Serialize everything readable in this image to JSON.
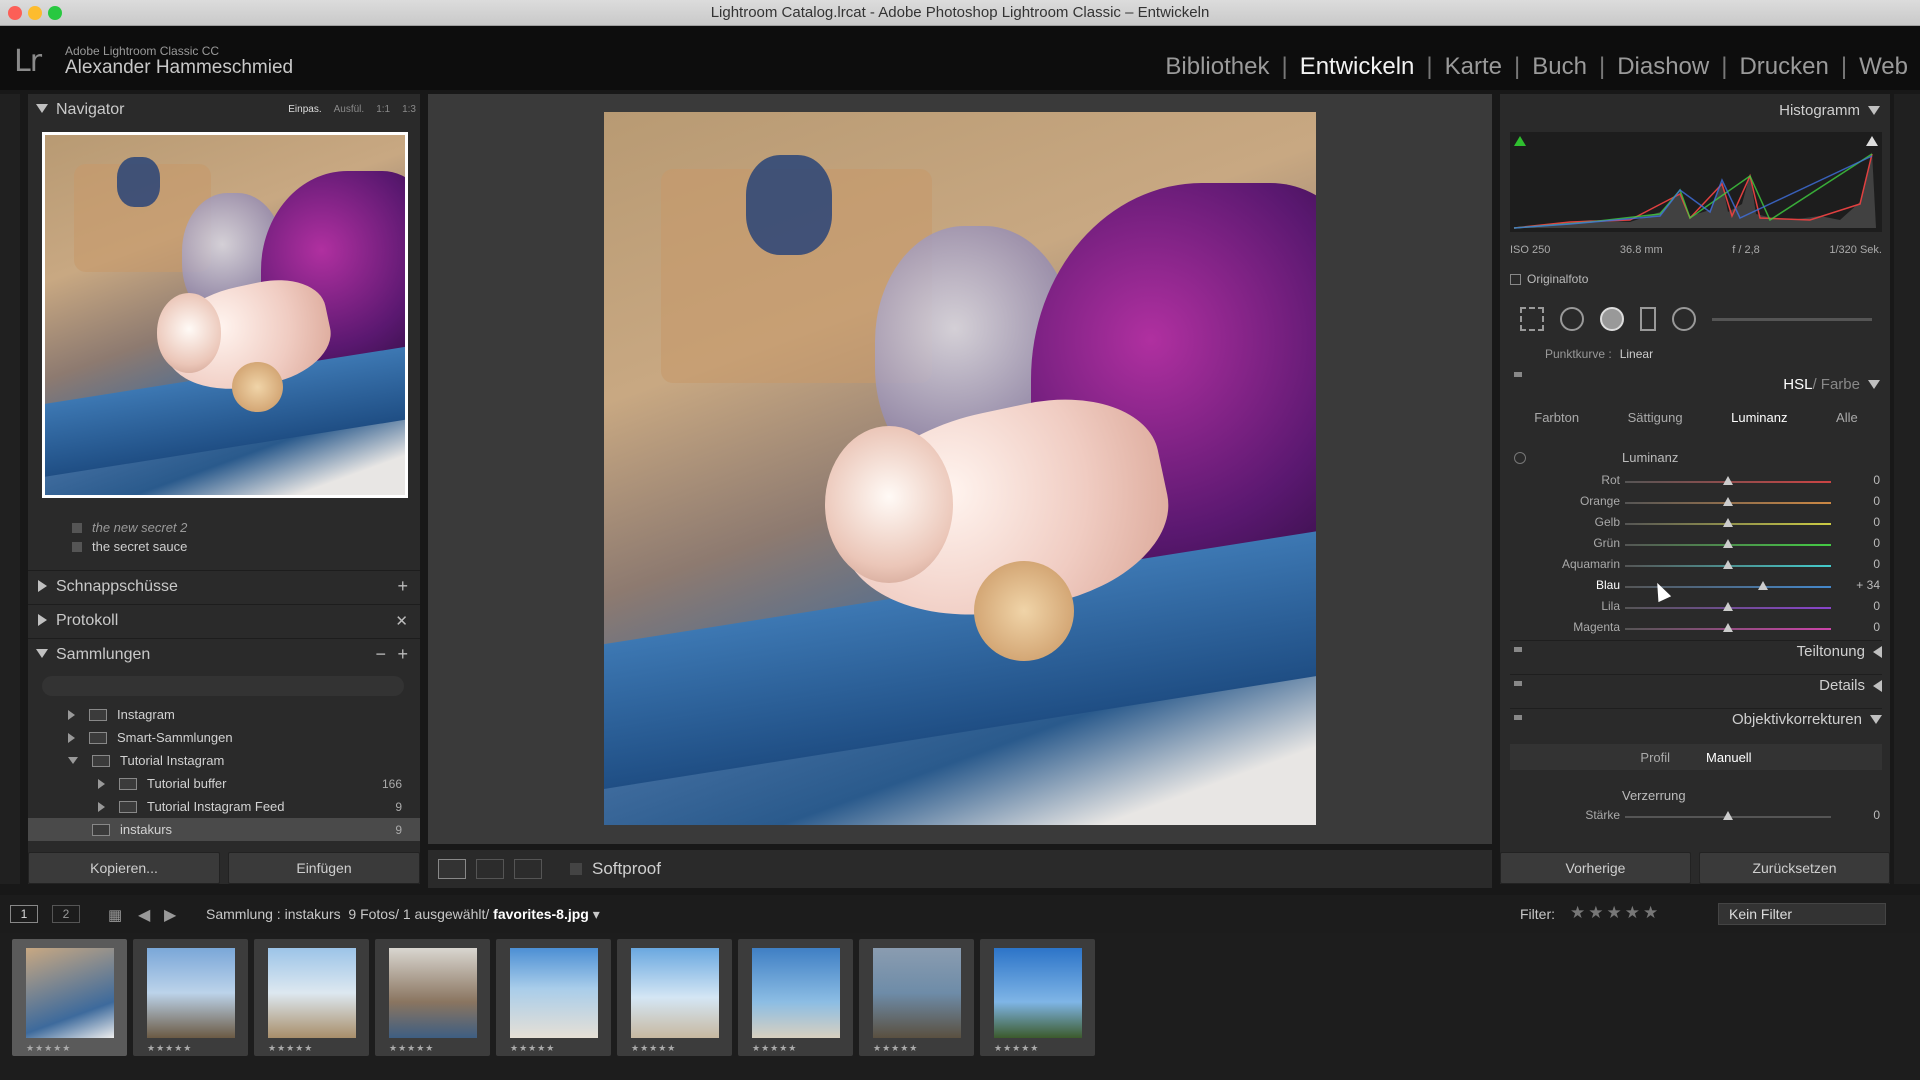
{
  "window": {
    "title": "Lightroom Catalog.lrcat - Adobe Photoshop Lightroom Classic – Entwickeln"
  },
  "header": {
    "logo": "Lr",
    "product": "Adobe Lightroom Classic CC",
    "user": "Alexander Hammeschmied",
    "modules": [
      "Bibliothek",
      "Entwickeln",
      "Karte",
      "Buch",
      "Diashow",
      "Drucken",
      "Web"
    ],
    "active_module": "Entwickeln"
  },
  "left": {
    "navigator": {
      "title": "Navigator",
      "options": [
        "Einpas.",
        "Ausfül.",
        "1:1",
        "1:3"
      ]
    },
    "presets": [
      "the new secret 2",
      "the secret sauce"
    ],
    "snapshots": "Schnappschüsse",
    "history": "Protokoll",
    "collections": {
      "title": "Sammlungen",
      "items": [
        {
          "label": "Instagram",
          "count": ""
        },
        {
          "label": "Smart-Sammlungen",
          "count": ""
        },
        {
          "label": "Tutorial Instagram",
          "count": ""
        },
        {
          "label": "Tutorial buffer",
          "count": "166"
        },
        {
          "label": "Tutorial Instagram Feed",
          "count": "9"
        },
        {
          "label": "instakurs",
          "count": "9"
        }
      ]
    },
    "copy_button": "Kopieren...",
    "paste_button": "Einfügen"
  },
  "toolbar": {
    "softproof": "Softproof"
  },
  "right": {
    "histogram": {
      "title": "Histogramm",
      "iso": "ISO 250",
      "focal": "36.8 mm",
      "aperture": "f / 2,8",
      "shutter": "1/320 Sek."
    },
    "original": "Originalfoto",
    "point_curve": {
      "label": "Punktkurve :",
      "value": "Linear"
    },
    "hsl": {
      "title_a": "HSL",
      "title_b": "/ Farbe",
      "tabs": [
        "Farbton",
        "Sättigung",
        "Luminanz",
        "Alle"
      ],
      "active": "Luminanz",
      "group": "Luminanz"
    },
    "sliders": [
      {
        "label": "Rot",
        "value": "0",
        "num": 0
      },
      {
        "label": "Orange",
        "value": "0",
        "num": 0
      },
      {
        "label": "Gelb",
        "value": "0",
        "num": 0
      },
      {
        "label": "Grün",
        "value": "0",
        "num": 0
      },
      {
        "label": "Aquamarin",
        "value": "0",
        "num": 0
      },
      {
        "label": "Blau",
        "value": "+ 34",
        "num": 34
      },
      {
        "label": "Lila",
        "value": "0",
        "num": 0
      },
      {
        "label": "Magenta",
        "value": "0",
        "num": 0
      }
    ],
    "split_toning": "Teiltonung",
    "details": "Details",
    "lens": {
      "title": "Objektivkorrekturen",
      "tabs": [
        "Profil",
        "Manuell"
      ],
      "active": "Manuell",
      "distortion": "Verzerrung",
      "strength": "Stärke",
      "strength_value": "0"
    },
    "prev_button": "Vorherige",
    "reset_button": "Zurücksetzen"
  },
  "filmbar": {
    "screen1": "1",
    "screen2": "2",
    "source": "Sammlung : instakurs",
    "count": "9 Fotos/ 1 ausgewählt/",
    "file": "favorites-8.jpg",
    "filter_label": "Filter:",
    "filter_value": "Kein Filter"
  },
  "filmstrip": {
    "stars": "★★★★★",
    "count": 9
  }
}
